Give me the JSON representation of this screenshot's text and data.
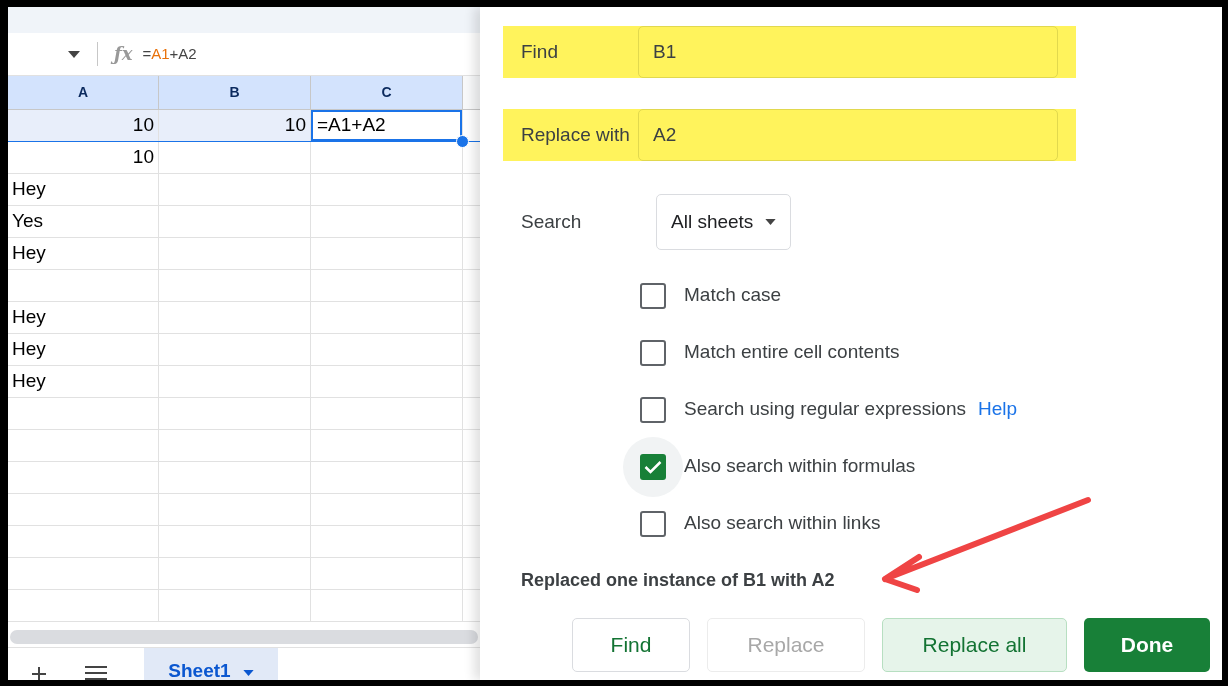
{
  "formula_bar": {
    "icon": "ƒx",
    "tokens": [
      {
        "text": "="
      },
      {
        "text": "A1",
        "color": "#e8710a"
      },
      {
        "text": "+A2"
      }
    ]
  },
  "columns": [
    {
      "label": "A",
      "selected": true
    },
    {
      "label": "B",
      "selected": true
    },
    {
      "label": "C",
      "selected": true
    }
  ],
  "rows": [
    {
      "selected": true,
      "A": {
        "text": "10",
        "kind": "number"
      },
      "B": {
        "text": "10",
        "kind": "number"
      },
      "C": {
        "text": "=A1+A2",
        "kind": "text",
        "active": true
      }
    },
    {
      "selected": false,
      "A": {
        "text": "10",
        "kind": "number"
      }
    },
    {
      "selected": false,
      "A": {
        "text": "Hey",
        "kind": "text"
      }
    },
    {
      "selected": false,
      "A": {
        "text": "Yes",
        "kind": "text"
      }
    },
    {
      "selected": false,
      "A": {
        "text": "Hey",
        "kind": "text"
      }
    },
    {
      "selected": false
    },
    {
      "selected": false,
      "A": {
        "text": "Hey",
        "kind": "text"
      }
    },
    {
      "selected": false,
      "A": {
        "text": "Hey",
        "kind": "text"
      }
    },
    {
      "selected": false,
      "A": {
        "text": "Hey",
        "kind": "text"
      }
    }
  ],
  "sheet_tabs": [
    {
      "label": "Sheet1",
      "selected": true
    }
  ],
  "dialog": {
    "fields": [
      {
        "label": "Find",
        "value": "B1",
        "highlighted": true
      },
      {
        "label": "Replace with",
        "value": "A2",
        "highlighted": true
      }
    ],
    "search": {
      "label": "Search",
      "value": "All sheets"
    },
    "options": [
      {
        "label": "Match case",
        "checked": false
      },
      {
        "label": "Match entire cell contents",
        "checked": false
      },
      {
        "label": "Search using regular expressions",
        "checked": false,
        "link": "Help"
      },
      {
        "label": "Also search within formulas",
        "checked": true
      },
      {
        "label": "Also search within links",
        "checked": false
      }
    ],
    "message": "Replaced one instance of B1 with A2",
    "buttons": [
      {
        "label": "Find",
        "kind": "outlined",
        "disabled": false
      },
      {
        "label": "Replace",
        "kind": "outlined",
        "disabled": true
      },
      {
        "label": "Replace all",
        "kind": "tonal",
        "disabled": false
      },
      {
        "label": "Done",
        "kind": "filled",
        "disabled": false
      }
    ]
  }
}
